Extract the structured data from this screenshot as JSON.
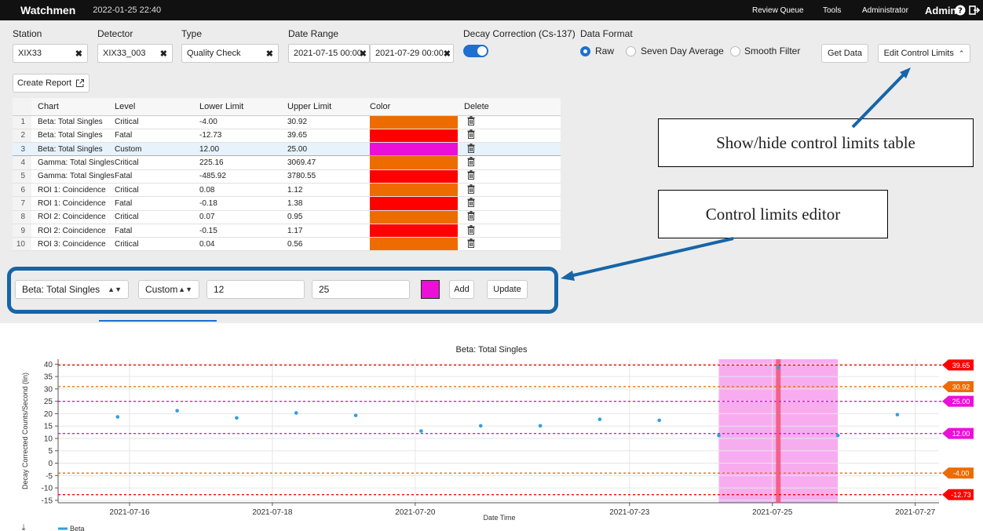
{
  "topbar": {
    "app_name": "Watchmen",
    "timestamp": "2022-01-25 22:40",
    "nav": [
      "Review Queue",
      "Tools",
      "Administrator"
    ],
    "user": "Admin"
  },
  "filters": {
    "station_label": "Station",
    "station_value": "XIX33",
    "detector_label": "Detector",
    "detector_value": "XIX33_003",
    "type_label": "Type",
    "type_value": "Quality Check",
    "date_label": "Date Range",
    "date_start": "2021-07-15 00:00",
    "date_end": "2021-07-29 00:00",
    "decay_label": "Decay Correction (Cs-137)",
    "format_label": "Data Format",
    "format_options": [
      "Raw",
      "Seven Day Average",
      "Smooth Filter"
    ],
    "format_selected": "Raw",
    "get_data": "Get Data",
    "edit_limits": "Edit Control Limits"
  },
  "create_report": "Create Report",
  "limits_table": {
    "columns": [
      "Chart",
      "Level",
      "Lower Limit",
      "Upper Limit",
      "Color",
      "Delete"
    ],
    "rows": [
      {
        "n": "1",
        "chart": "Beta: Total Singles",
        "level": "Critical",
        "lower": "-4.00",
        "upper": "30.92",
        "color": "#ee6b00"
      },
      {
        "n": "2",
        "chart": "Beta: Total Singles",
        "level": "Fatal",
        "lower": "-12.73",
        "upper": "39.65",
        "color": "#ff0000"
      },
      {
        "n": "3",
        "chart": "Beta: Total Singles",
        "level": "Custom",
        "lower": "12.00",
        "upper": "25.00",
        "color": "#ea10d8"
      },
      {
        "n": "4",
        "chart": "Gamma: Total Singles",
        "level": "Critical",
        "lower": "225.16",
        "upper": "3069.47",
        "color": "#ee6b00"
      },
      {
        "n": "5",
        "chart": "Gamma: Total Singles",
        "level": "Fatal",
        "lower": "-485.92",
        "upper": "3780.55",
        "color": "#ff0000"
      },
      {
        "n": "6",
        "chart": "ROI 1: Coincidence",
        "level": "Critical",
        "lower": "0.08",
        "upper": "1.12",
        "color": "#ee6b00"
      },
      {
        "n": "7",
        "chart": "ROI 1: Coincidence",
        "level": "Fatal",
        "lower": "-0.18",
        "upper": "1.38",
        "color": "#ff0000"
      },
      {
        "n": "8",
        "chart": "ROI 2: Coincidence",
        "level": "Critical",
        "lower": "0.07",
        "upper": "0.95",
        "color": "#ee6b00"
      },
      {
        "n": "9",
        "chart": "ROI 2: Coincidence",
        "level": "Fatal",
        "lower": "-0.15",
        "upper": "1.17",
        "color": "#ff0000"
      },
      {
        "n": "10",
        "chart": "ROI 3: Coincidence",
        "level": "Critical",
        "lower": "0.04",
        "upper": "0.56",
        "color": "#ee6b00"
      }
    ],
    "selected_row": 2
  },
  "annotations": {
    "show_hide": "Show/hide control limits table",
    "editor": "Control limits editor"
  },
  "editor": {
    "chart_value": "Beta: Total Singles",
    "level_value": "Custom",
    "lower_value": "12",
    "upper_value": "25",
    "swatch_color": "#ea10d8",
    "add": "Add",
    "update": "Update"
  },
  "colors": {
    "accent": "#1e6fd1",
    "editor_border": "#1565a8",
    "critical": "#ee6b00",
    "fatal": "#ff0000",
    "custom": "#ea10d8",
    "point": "#2f9fe0"
  },
  "chart_data": {
    "type": "scatter",
    "title": "Beta: Total Singles",
    "xlabel": "Date Time",
    "ylabel": "Decay Corrected Counts/Second (lin)",
    "ylim": [
      -16,
      42
    ],
    "yticks": [
      -15,
      -10,
      -5,
      0,
      5,
      10,
      15,
      20,
      25,
      30,
      35,
      40
    ],
    "xticks": [
      "2021-07-16",
      "2021-07-18",
      "2021-07-20",
      "2021-07-23",
      "2021-07-25",
      "2021-07-27"
    ],
    "grid": true,
    "legend_position": "bottom-left",
    "series": [
      {
        "name": "Beta",
        "points": [
          {
            "x": "2021-07-15 20:00",
            "y": 18.7
          },
          {
            "x": "2021-07-16 16:00",
            "y": 21.2
          },
          {
            "x": "2021-07-17 12:00",
            "y": 18.3
          },
          {
            "x": "2021-07-18 08:00",
            "y": 20.3
          },
          {
            "x": "2021-07-19 04:00",
            "y": 19.3
          },
          {
            "x": "2021-07-20 02:00",
            "y": 13.0
          },
          {
            "x": "2021-07-20 22:00",
            "y": 15.1
          },
          {
            "x": "2021-07-21 18:00",
            "y": 15.1
          },
          {
            "x": "2021-07-22 14:00",
            "y": 17.7
          },
          {
            "x": "2021-07-23 10:00",
            "y": 17.3
          },
          {
            "x": "2021-07-24 06:00",
            "y": 11.2
          },
          {
            "x": "2021-07-25 02:00",
            "y": 38.7
          },
          {
            "x": "2021-07-25 22:00",
            "y": 11.2
          },
          {
            "x": "2021-07-26 18:00",
            "y": 19.6
          }
        ]
      }
    ],
    "limit_lines": [
      {
        "value": 39.65,
        "label": "39.65",
        "color": "#ff0000"
      },
      {
        "value": 30.92,
        "label": "30.92",
        "color": "#ee6b00"
      },
      {
        "value": 25.0,
        "label": "25.00",
        "color": "#ea10d8"
      },
      {
        "value": 12.0,
        "label": "12.00",
        "color": "#ea10d8"
      },
      {
        "value": -4.0,
        "label": "-4.00",
        "color": "#ee6b00"
      },
      {
        "value": -12.73,
        "label": "-12.73",
        "color": "#ff0000"
      }
    ],
    "highlight_range": {
      "start": "2021-07-24 06:00",
      "end": "2021-07-25 22:00",
      "color": "#f7a3ee"
    },
    "highlight_marker": {
      "x": "2021-07-25 02:00",
      "color": "#ee5577"
    }
  }
}
